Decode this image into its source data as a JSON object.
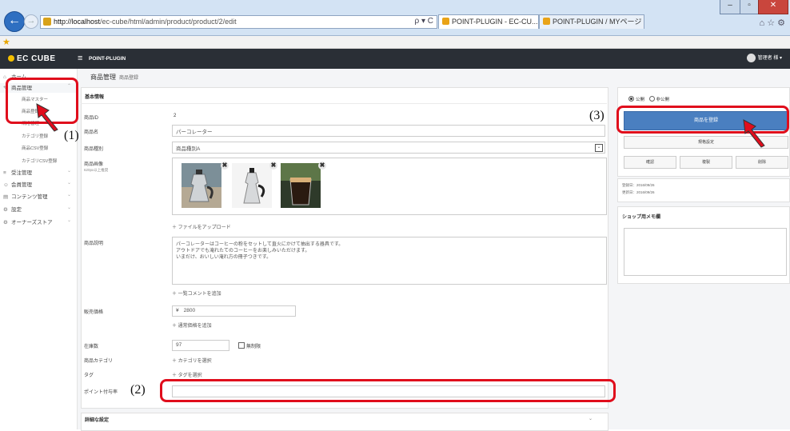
{
  "browser": {
    "url_host": "http://localhost",
    "url_path": "/ec-cube/html/admin/product/product/2/edit",
    "address_controls": "ρ ▾ C",
    "tabs": [
      {
        "label": "POINT-PLUGIN - EC-CU...",
        "close": "×"
      },
      {
        "label": "POINT-PLUGIN / MYページ"
      }
    ],
    "window_controls": [
      "–",
      "▫",
      "✕"
    ],
    "tool_icons": "⌂ ☆ ⚙"
  },
  "admin": {
    "logo": "EC CUBE",
    "menu_icon": "≡",
    "shop_name": "POINT-PLUGIN",
    "user_name": "管理者 様"
  },
  "sidebar": {
    "home": "ホーム",
    "product_menu": "商品管理",
    "product_sub": [
      "商品マスター",
      "商品登録",
      "規格管理",
      "カテゴリ登録",
      "商品CSV登録",
      "カテゴリCSV登録"
    ],
    "items": [
      "受注管理",
      "会員管理",
      "コンテンツ管理",
      "設定",
      "オーナーズストア"
    ]
  },
  "page": {
    "title": "商品管理",
    "subtitle": "商品登録"
  },
  "form": {
    "section_title": "基本情報",
    "product_id_label": "商品ID",
    "product_id": "2",
    "name_label": "商品名",
    "name_value": "パーコレーター",
    "type_label": "商品種別",
    "type_value": "商品種別A",
    "image_label": "商品画像",
    "image_hint": "620px以上推奨",
    "upload_link": "ファイルをアップロード",
    "desc_label": "商品説明",
    "desc_lines": [
      "パーコレーターはコーヒーの粉をセットして直火にかけて抽出する器具です。",
      "アウトドアでも淹れたてのコーヒーをお楽しみいただけます。",
      "いまだけ、おいしい淹れ方の冊子つきです。"
    ],
    "add_comment": "一覧コメントを追加",
    "price_label": "販売価格",
    "currency": "¥",
    "price_value": "2800",
    "add_price": "通常価格を追加",
    "stock_label": "在庫数",
    "stock_value": "97",
    "unlimited": "無制限",
    "category_label": "商品カテゴリ",
    "category_link": "カテゴリを選択",
    "tag_label": "タグ",
    "tag_link": "タグを選択",
    "point_label": "ポイント付与率",
    "point_value": "",
    "detail_section": "詳細な設定"
  },
  "side": {
    "public": "公開",
    "private": "非公開",
    "register_button": "商品を登録",
    "class_button": "規格設定",
    "confirm_button": "確認",
    "copy_button": "複製",
    "delete_button": "削除",
    "created": "登録日：2016/09/26",
    "updated": "更新日：2016/09/26",
    "memo_title": "ショップ用メモ欄"
  },
  "annotations": [
    "(1)",
    "(2)",
    "(3)"
  ],
  "colors": {
    "highlight": "#e00d1c",
    "primary_button": "#4a7fc0",
    "admin_header": "#2a2f36"
  }
}
